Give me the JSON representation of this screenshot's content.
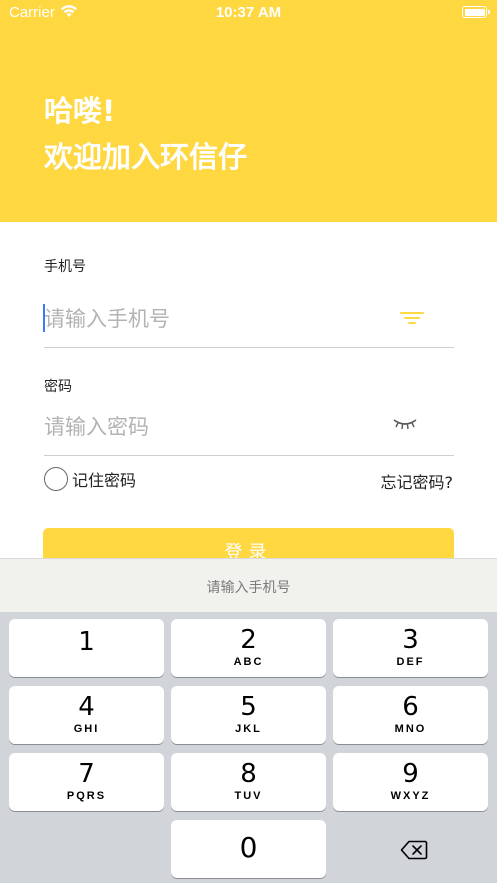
{
  "status_bar": {
    "carrier": "Carrier",
    "time": "10:37 AM"
  },
  "header": {
    "line1": "哈喽!",
    "line2": "欢迎加入环信仔"
  },
  "phone": {
    "label": "手机号",
    "placeholder": "请输入手机号"
  },
  "password": {
    "label": "密码",
    "placeholder": "请输入密码"
  },
  "remember": {
    "label": "记住密码"
  },
  "forgot": {
    "label": "忘记密码?"
  },
  "login": {
    "label": "登录"
  },
  "keyboard_bar": {
    "placeholder": "请输入手机号"
  },
  "keypad": {
    "k1": {
      "num": "1",
      "letters": ""
    },
    "k2": {
      "num": "2",
      "letters": "ABC"
    },
    "k3": {
      "num": "3",
      "letters": "DEF"
    },
    "k4": {
      "num": "4",
      "letters": "GHI"
    },
    "k5": {
      "num": "5",
      "letters": "JKL"
    },
    "k6": {
      "num": "6",
      "letters": "MNO"
    },
    "k7": {
      "num": "7",
      "letters": "PQRS"
    },
    "k8": {
      "num": "8",
      "letters": "TUV"
    },
    "k9": {
      "num": "9",
      "letters": "WXYZ"
    },
    "k0": {
      "num": "0"
    },
    "delete_icon": "backspace-icon"
  },
  "colors": {
    "accent": "#FFD741",
    "caret": "#3B7BF7",
    "keyboard_bg": "#D1D4D9"
  },
  "icons": {
    "wifi": "wifi-icon",
    "battery": "battery-icon",
    "filter": "filter-icon",
    "eye": "eye-closed-icon"
  }
}
